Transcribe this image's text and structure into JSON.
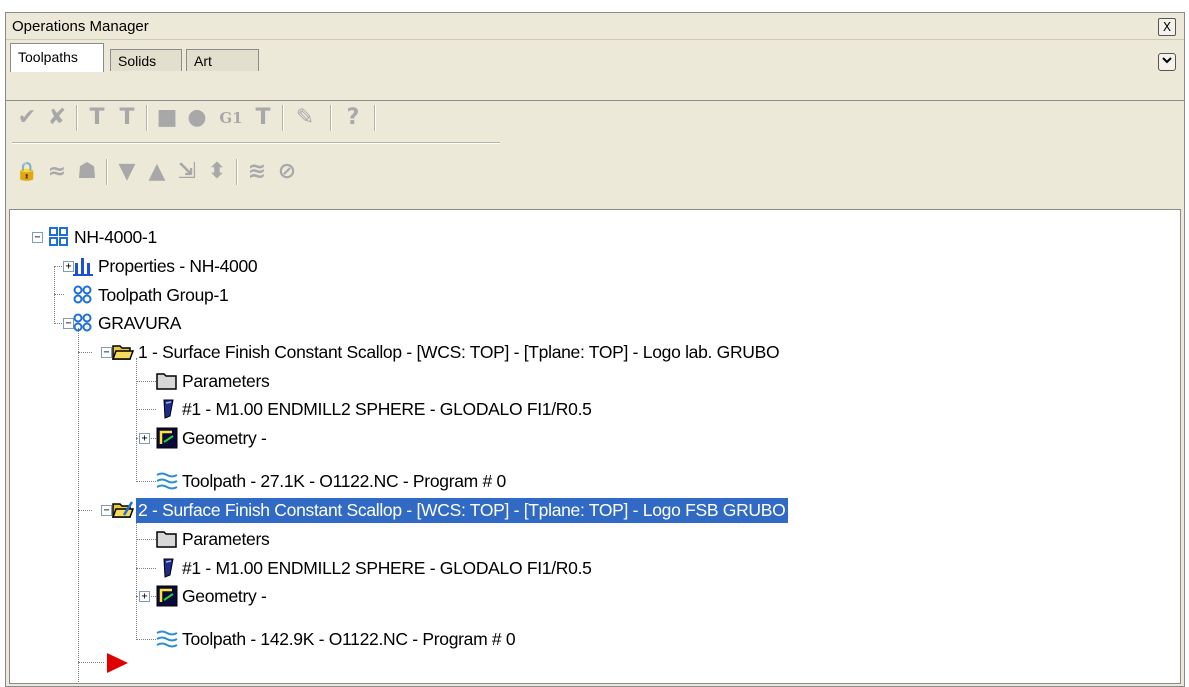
{
  "window": {
    "title": "Operations Manager",
    "close_glyph": "X"
  },
  "tabs": [
    {
      "label": "Toolpaths",
      "active": true
    },
    {
      "label": "Solids",
      "active": false
    },
    {
      "label": "Art",
      "active": false
    }
  ],
  "toolbar_row1": [
    "select-all-ops-icon",
    "select-dirty-ops-icon",
    "regenerate-selected-icon",
    "regenerate-dirty-icon",
    "backplot-icon",
    "verify-icon",
    "g1-post-icon",
    "post-selected-icon",
    "high-feed-icon",
    "help-icon"
  ],
  "toolbar_row2": [
    "lock-icon",
    "toggle-display-icon",
    "toggle-posting-icon",
    "move-down-icon",
    "move-up-icon",
    "insert-after-icon",
    "scroll-icon",
    "single-display-icon",
    "show-associated-icon"
  ],
  "toolbar_glyphs": {
    "row1": [
      "✔",
      "✘",
      "T",
      "T",
      "■",
      "●",
      "G1",
      "T",
      "✎",
      "?"
    ],
    "row2": [
      "🔒",
      "≈",
      "☗",
      "▼",
      "▲",
      "⇲",
      "⬍",
      "≋",
      "⊘"
    ]
  },
  "tree": {
    "root": "NH-4000-1",
    "properties": "Properties - NH-4000",
    "group1": "Toolpath Group-1",
    "group2": "GRAVURA",
    "op1": {
      "label": "1 - Surface Finish Constant Scallop - [WCS: TOP] - [Tplane: TOP] - Logo lab. GRUBO",
      "parameters": "Parameters",
      "tool": "#1 - M1.00 ENDMILL2 SPHERE - GLODALO FI1/R0.5",
      "geometry": "Geometry -",
      "toolpath": "Toolpath - 27.1K - O1122.NC - Program # 0"
    },
    "op2": {
      "label": "2 - Surface Finish Constant Scallop - [WCS: TOP] - [Tplane: TOP] - Logo FSB GRUBO",
      "selected": true,
      "parameters": "Parameters",
      "tool": "#1 - M1.00 ENDMILL2 SPHERE - GLODALO FI1/R0.5",
      "geometry": "Geometry -",
      "toolpath": "Toolpath - 142.9K - O1122.NC - Program # 0"
    },
    "insert_arrow": "insert-arrow-icon"
  },
  "colors": {
    "panel_bg": "#ece9d8",
    "selection": "#316ac5",
    "insert_arrow": "#e00000",
    "group_icon": "#1e6fd9"
  }
}
